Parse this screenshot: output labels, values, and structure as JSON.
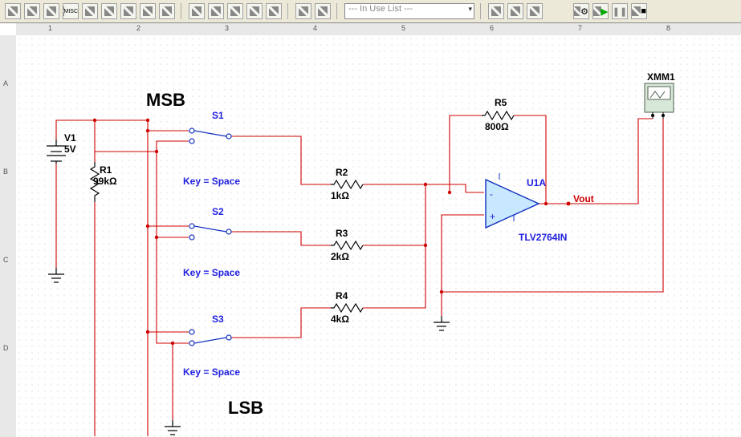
{
  "domain": "Diagram",
  "app": "NI Multisim Schematic",
  "toolbar": {
    "dropdown_placeholder": "--- In Use List ---",
    "buttons": [
      "comp",
      "dio",
      "tran",
      "misc",
      "gate",
      "opamp",
      "ind",
      "source",
      "probe",
      "scope"
    ],
    "run_controls": [
      "config-run",
      "run",
      "pause",
      "stop"
    ]
  },
  "ruler": {
    "h": [
      "1",
      "2",
      "3",
      "4",
      "5",
      "6",
      "7",
      "8"
    ],
    "v": [
      "A",
      "B",
      "C",
      "D"
    ]
  },
  "labels": {
    "msb": "MSB",
    "lsb": "LSB",
    "vout": "Vout"
  },
  "components": {
    "V1": {
      "ref": "V1",
      "value": "5V",
      "type": "dc_source"
    },
    "R1": {
      "ref": "R1",
      "value": "99kΩ",
      "type": "resistor"
    },
    "R2": {
      "ref": "R2",
      "value": "1kΩ",
      "type": "resistor"
    },
    "R3": {
      "ref": "R3",
      "value": "2kΩ",
      "type": "resistor"
    },
    "R4": {
      "ref": "R4",
      "value": "4kΩ",
      "type": "resistor"
    },
    "R5": {
      "ref": "R5",
      "value": "800Ω",
      "type": "resistor"
    },
    "S1": {
      "ref": "S1",
      "key": "Key = Space",
      "type": "spdt_switch"
    },
    "S2": {
      "ref": "S2",
      "key": "Key = Space",
      "type": "spdt_switch"
    },
    "S3": {
      "ref": "S3",
      "key": "Key = Space",
      "type": "spdt_switch"
    },
    "U1A": {
      "ref": "U1A",
      "model": "TLV2764IN",
      "type": "opamp"
    },
    "XMM1": {
      "ref": "XMM1",
      "type": "multimeter"
    }
  }
}
